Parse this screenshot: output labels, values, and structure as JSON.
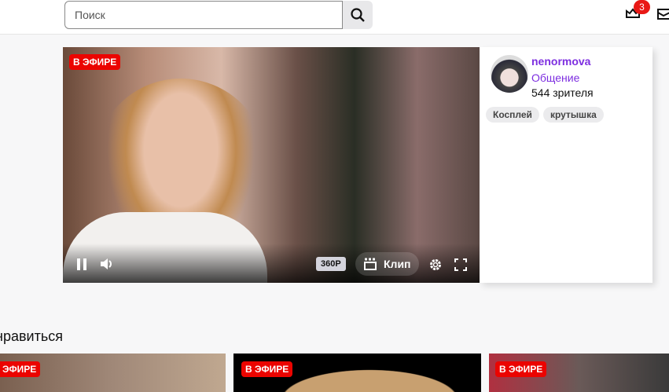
{
  "header": {
    "search_placeholder": "Поиск",
    "notifications_count": "3"
  },
  "player": {
    "live_label": "В ЭФИРЕ",
    "quality": "360P",
    "clip_label": "Клип"
  },
  "channel": {
    "name": "nenormova",
    "category": "Общение",
    "viewers": "544 зрителя",
    "tags": [
      "Косплей",
      "крутышка"
    ]
  },
  "recommended": {
    "title": "нравиться",
    "items": [
      {
        "live_label": "В ЭФИРЕ"
      },
      {
        "live_label": "В ЭФИРЕ"
      },
      {
        "live_label": "В ЭФИРЕ"
      }
    ]
  },
  "colors": {
    "accent": "#7d2ee0",
    "live": "#eb0400"
  }
}
